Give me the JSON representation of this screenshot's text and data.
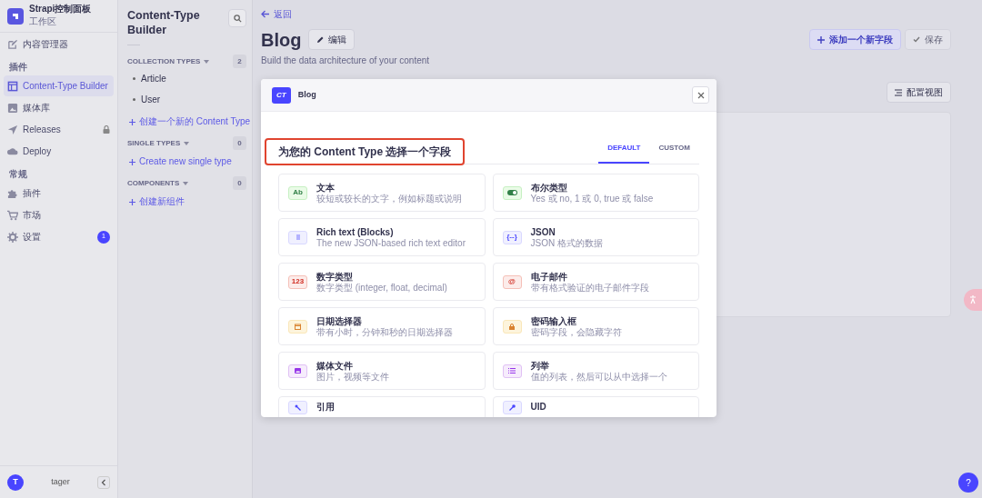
{
  "app": {
    "title": "Strapi控制面板",
    "subtitle": "工作区"
  },
  "nav_groups": [
    {
      "items": [
        {
          "label": "内容管理器",
          "kind": "content",
          "selected": false
        }
      ]
    },
    {
      "heading": "插件",
      "items": [
        {
          "label": "Content-Type Builder",
          "kind": "builder",
          "selected": true
        },
        {
          "label": "媒体库",
          "kind": "media",
          "selected": false
        },
        {
          "label": "Releases",
          "kind": "releases",
          "selected": false,
          "locked": true
        },
        {
          "label": "Deploy",
          "kind": "cloud",
          "selected": false
        }
      ]
    },
    {
      "heading": "常规",
      "items": [
        {
          "label": "插件",
          "kind": "puzzle",
          "selected": false
        },
        {
          "label": "市场",
          "kind": "cart",
          "selected": false
        },
        {
          "label": "设置",
          "kind": "gear",
          "selected": false,
          "badge": "1"
        }
      ]
    }
  ],
  "user": {
    "initial": "T",
    "name": "tager"
  },
  "help_button": "?",
  "builder": {
    "title": "Content-Type Builder",
    "sections": [
      {
        "heading": "COLLECTION TYPES",
        "count": "2",
        "items": [
          "Article",
          "User"
        ],
        "create_link": "创建一个新的 Content Type"
      },
      {
        "heading": "SINGLE TYPES",
        "count": "0",
        "create_link": "Create new single type"
      },
      {
        "heading": "COMPONENTS",
        "count": "0",
        "create_link": "创建新组件"
      }
    ]
  },
  "header": {
    "back": "返回",
    "title": "Blog",
    "edit_button": "编辑",
    "subtitle": "Build the data architecture of your content",
    "add_button": "添加一个新字段",
    "save_button": {
      "label": "保存",
      "disabled": true
    },
    "configure_button": "配置视图"
  },
  "modal": {
    "badge": "CT",
    "name": "Blog",
    "title": "为您的 Content Type 选择一个字段",
    "tabs": [
      {
        "label": "DEFAULT",
        "selected": true
      },
      {
        "label": "CUSTOM",
        "selected": false
      }
    ],
    "fields": [
      {
        "kind": "text",
        "icon_label": "Ab",
        "title": "文本",
        "description": "较短或较长的文字，例如标题或说明"
      },
      {
        "kind": "boolean",
        "title": "布尔类型",
        "description": "Yes 或 no, 1 或 0, true 或 false"
      },
      {
        "kind": "blocks",
        "title": "Rich text (Blocks)",
        "description": "The new JSON-based rich text editor"
      },
      {
        "kind": "json",
        "icon_label": "{--}",
        "title": "JSON",
        "description": "JSON 格式的数据"
      },
      {
        "kind": "number",
        "icon_label": "123",
        "title": "数字类型",
        "description": "数字类型 (integer, float, decimal)"
      },
      {
        "kind": "email",
        "icon_label": "@",
        "title": "电子邮件",
        "description": "带有格式验证的电子邮件字段"
      },
      {
        "kind": "date",
        "title": "日期选择器",
        "description": "带有小时，分钟和秒的日期选择器"
      },
      {
        "kind": "password",
        "title": "密码输入框",
        "description": "密码字段，会隐藏字符"
      },
      {
        "kind": "media",
        "title": "媒体文件",
        "description": "图片，视频等文件"
      },
      {
        "kind": "enumeration",
        "title": "列举",
        "description": "值的列表，然后可以从中选择一个"
      },
      {
        "kind": "relation",
        "title": "引用"
      },
      {
        "kind": "uid",
        "title": "UID"
      }
    ]
  }
}
